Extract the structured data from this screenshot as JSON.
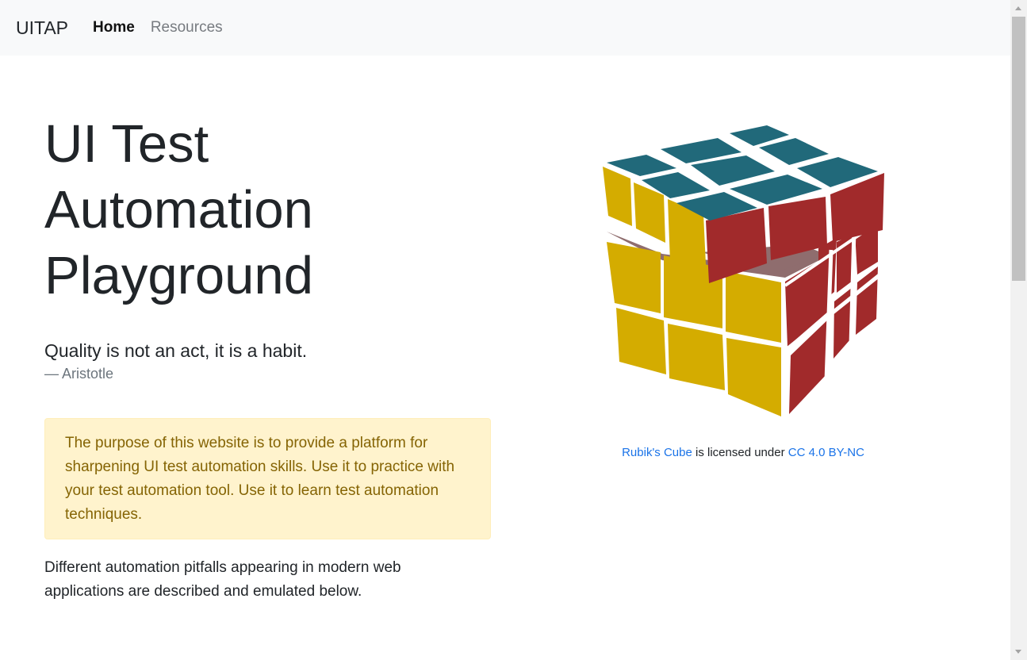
{
  "navbar": {
    "brand": "UITAP",
    "links": [
      {
        "label": "Home",
        "active": true
      },
      {
        "label": "Resources",
        "active": false
      }
    ]
  },
  "hero": {
    "title": "UI Test Automation Playground"
  },
  "quote": {
    "text": "Quality is not an act, it is a habit.",
    "author": "— Aristotle"
  },
  "alert": {
    "text": "The purpose of this website is to provide a platform for sharpening UI test automation skills. Use it to practice with your test automation tool. Use it to learn test automation techniques."
  },
  "description": "Different automation pitfalls appearing in modern web applications are described and emulated below.",
  "image": {
    "icon": "rubiks-cube",
    "credit": {
      "work_link": "Rubik's Cube",
      "middle_text": " is licensed under ",
      "license_link": "CC 4.0 BY-NC"
    }
  },
  "colors": {
    "cube_top": "#21697a",
    "cube_front": "#d4ac00",
    "cube_right": "#a12a2b",
    "alert_bg": "#fff3cd",
    "alert_text": "#856404",
    "link": "#1a73e8"
  }
}
